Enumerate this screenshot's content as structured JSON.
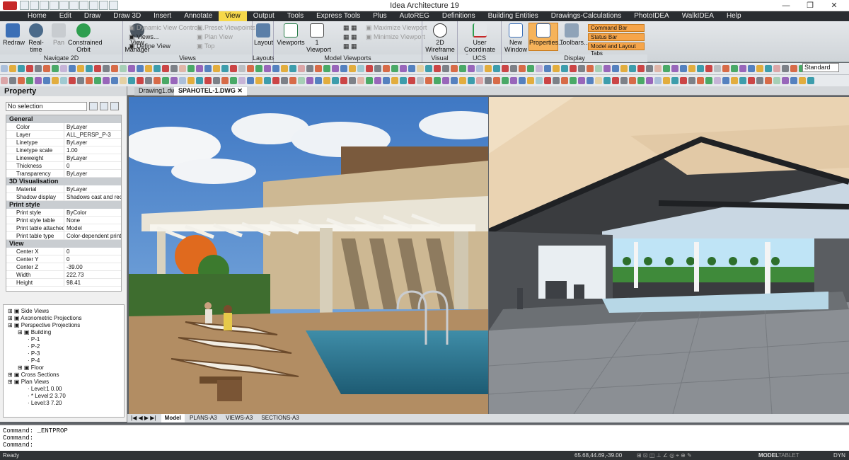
{
  "app": {
    "title": "Idea Architecture 19",
    "window_controls": [
      "—",
      "❐",
      "✕"
    ]
  },
  "menu": [
    "Home",
    "Edit",
    "Draw",
    "Draw 3D",
    "Insert",
    "Annotate",
    "View",
    "Output",
    "Tools",
    "Express Tools",
    "Plus",
    "AutoREG",
    "Definitions",
    "Building Entities",
    "Drawings-Calculations",
    "PhotoIDEA",
    "WalkIDEA",
    "Help"
  ],
  "menu_active": "View",
  "ribbon": {
    "navigate": {
      "label": "Navigate 2D",
      "redraw": "Redraw",
      "realtime": "Real-time zooming",
      "pan": "Pan",
      "orbit": "Constrained Orbit"
    },
    "views": {
      "label": "Views",
      "manager": "View Manager",
      "dynamic": "Dynamic View Control...",
      "views": "Views...",
      "define": "Define View",
      "preset": "Preset Viewpoints...",
      "plan": "Plan View",
      "top": "Top"
    },
    "layouts": {
      "label": "Layouts",
      "layout": "Layout"
    },
    "viewports": {
      "label": "Model Viewports",
      "viewports": "Viewports",
      "one": "1 Viewport",
      "maximize": "Maximize Viewport",
      "minimize": "Minimize Viewport"
    },
    "visual": {
      "label": "Visual Styles",
      "wire": "2D Wireframe"
    },
    "ucs": {
      "label": "UCS",
      "user": "User Coordinate Systems..."
    },
    "display": {
      "label": "Display",
      "new_window": "New Window",
      "properties": "Properties...",
      "toolbars": "Toolbars...",
      "command_bar": "Command Bar",
      "status_bar": "Status Bar",
      "model_tabs": "Model and Layout Tabs"
    }
  },
  "style_box": "Standard",
  "property_panel": {
    "title": "Property",
    "selection": "No selection",
    "sections": [
      {
        "name": "General",
        "rows": [
          [
            "Color",
            "ByLayer"
          ],
          [
            "Layer",
            "ALL_PERSP_P-3"
          ],
          [
            "Linetype",
            "ByLayer"
          ],
          [
            "Linetype scale",
            "1.00"
          ],
          [
            "Lineweight",
            "ByLayer"
          ],
          [
            "Thickness",
            "0"
          ],
          [
            "Transparency",
            "ByLayer"
          ]
        ]
      },
      {
        "name": "3D Visualisation",
        "rows": [
          [
            "Material",
            "ByLayer"
          ],
          [
            "Shadow display",
            "Shadows cast and rec..."
          ]
        ]
      },
      {
        "name": "Print style",
        "rows": [
          [
            "Print style",
            "ByColor"
          ],
          [
            "Print style table",
            "None"
          ],
          [
            "Print table attached to",
            "Model"
          ],
          [
            "Print table type",
            "Color-dependent print ..."
          ]
        ]
      },
      {
        "name": "View",
        "rows": [
          [
            "Center X",
            "0"
          ],
          [
            "Center Y",
            "0"
          ],
          [
            "Center Z",
            "-39.00"
          ],
          [
            "Width",
            "222.73"
          ],
          [
            "Height",
            "98.41"
          ]
        ]
      }
    ]
  },
  "tree": [
    {
      "label": "Side Views",
      "level": 0
    },
    {
      "label": "Axonometric Projections",
      "level": 0
    },
    {
      "label": "Perspective Projections",
      "level": 0
    },
    {
      "label": "Building",
      "level": 1
    },
    {
      "label": "P-1",
      "level": 2
    },
    {
      "label": "P-2",
      "level": 2
    },
    {
      "label": "P-3",
      "level": 2
    },
    {
      "label": "P-4",
      "level": 2
    },
    {
      "label": "Floor",
      "level": 1
    },
    {
      "label": "Cross Sections",
      "level": 0
    },
    {
      "label": "Plan Views",
      "level": 0
    },
    {
      "label": "Level:1  0.00",
      "level": 2
    },
    {
      "label": "* Level:2  3.70",
      "level": 2
    },
    {
      "label": "Level:3  7.20",
      "level": 2
    }
  ],
  "doc_tabs": {
    "first": "Drawing1.dwg",
    "second": "SPAHOTEL-1.DWG",
    "close": "✕"
  },
  "layout_tabs": {
    "nav": "|◀ ◀ ▶ ▶|",
    "model": "Model",
    "plans": "PLANS-A3",
    "views": "VIEWS-A3",
    "sections": "SECTIONS-A3"
  },
  "command": {
    "line1": "Command:  _ENTPROP",
    "line2": "Command:",
    "line3": "Command:"
  },
  "status": {
    "ready": "Ready",
    "coords": "65.68,44.69,-39.00",
    "model": "MODEL",
    "tablet": "TABLET",
    "dyn": "DYN"
  }
}
